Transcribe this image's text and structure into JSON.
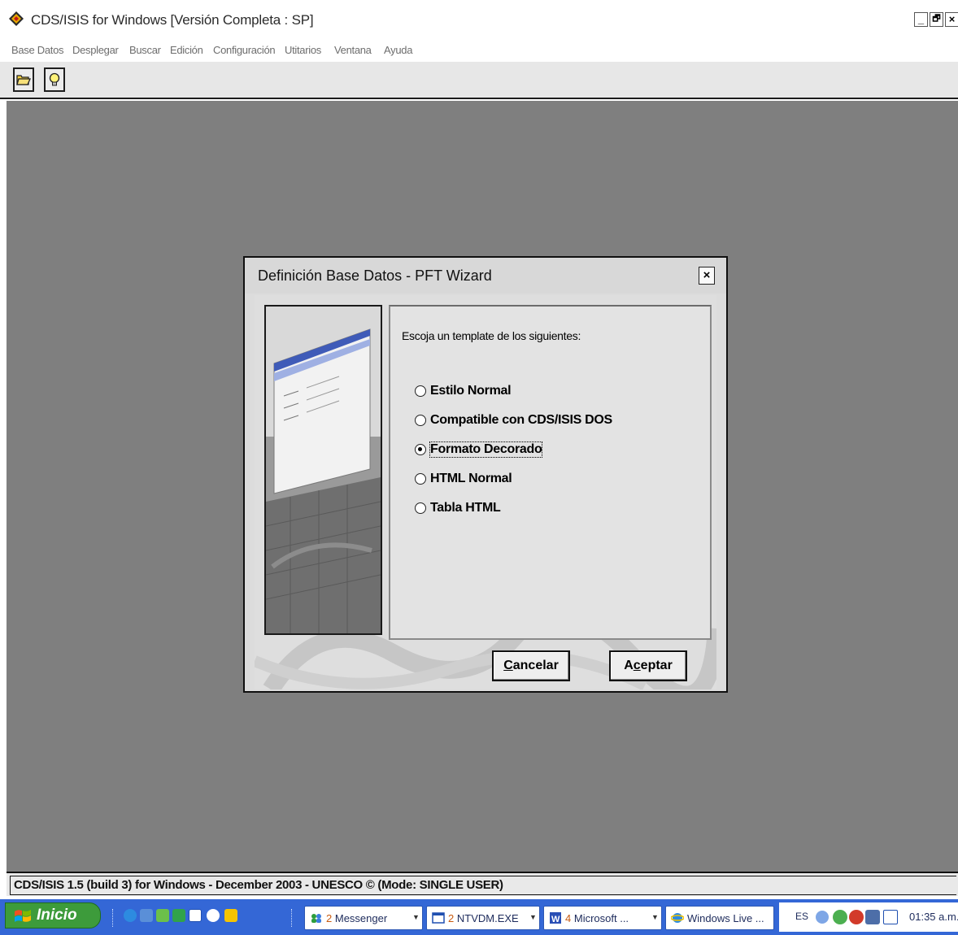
{
  "window": {
    "title": "CDS/ISIS for Windows [Versión Completa : SP]",
    "controls": {
      "minimize": "_",
      "restore": "🗗",
      "close": "×"
    }
  },
  "menu": [
    "Base Datos",
    "Desplegar",
    "Buscar",
    "Edición",
    "Configuración",
    "Utitarios",
    "Ventana",
    "Ayuda"
  ],
  "toolbar": {
    "buttons": [
      "open-folder-icon",
      "lightbulb-icon"
    ]
  },
  "dialog": {
    "title": "Definición Base Datos - PFT Wizard",
    "close": "×",
    "prompt": "Escoja un  template de los siguientes:",
    "options": [
      {
        "label": "Estilo Normal",
        "selected": false
      },
      {
        "label": "Compatible con CDS/ISIS DOS",
        "selected": false
      },
      {
        "label": "Formato Decorado",
        "selected": true
      },
      {
        "label": "HTML Normal",
        "selected": false
      },
      {
        "label": "Tabla HTML",
        "selected": false
      }
    ],
    "cancel_label": "Cancelar",
    "accept_label": "Aceptar",
    "cancel_access_key": "C",
    "accept_access_key": "c"
  },
  "statusbar": {
    "text": "CDS/ISIS 1.5 (build 3) for Windows - December 2003 - UNESCO © (Mode: SINGLE USER)"
  },
  "taskbar": {
    "start_label": "Inicio",
    "tasks": [
      {
        "count": "2",
        "label": "Messenger",
        "icon": "messenger-icon"
      },
      {
        "count": "2",
        "label": "NTVDM.EXE",
        "icon": "window-icon"
      },
      {
        "count": "4",
        "label": "Microsoft ...",
        "icon": "word-icon"
      },
      {
        "count": "",
        "label": "Windows Live ...",
        "icon": "ie-icon"
      }
    ],
    "tray": {
      "language": "ES",
      "time": "01:35 a.m."
    }
  },
  "colors": {
    "mdi_background": "#7f7f7f",
    "taskbar": "#3467d6",
    "start_button": "#3d9b3b"
  }
}
